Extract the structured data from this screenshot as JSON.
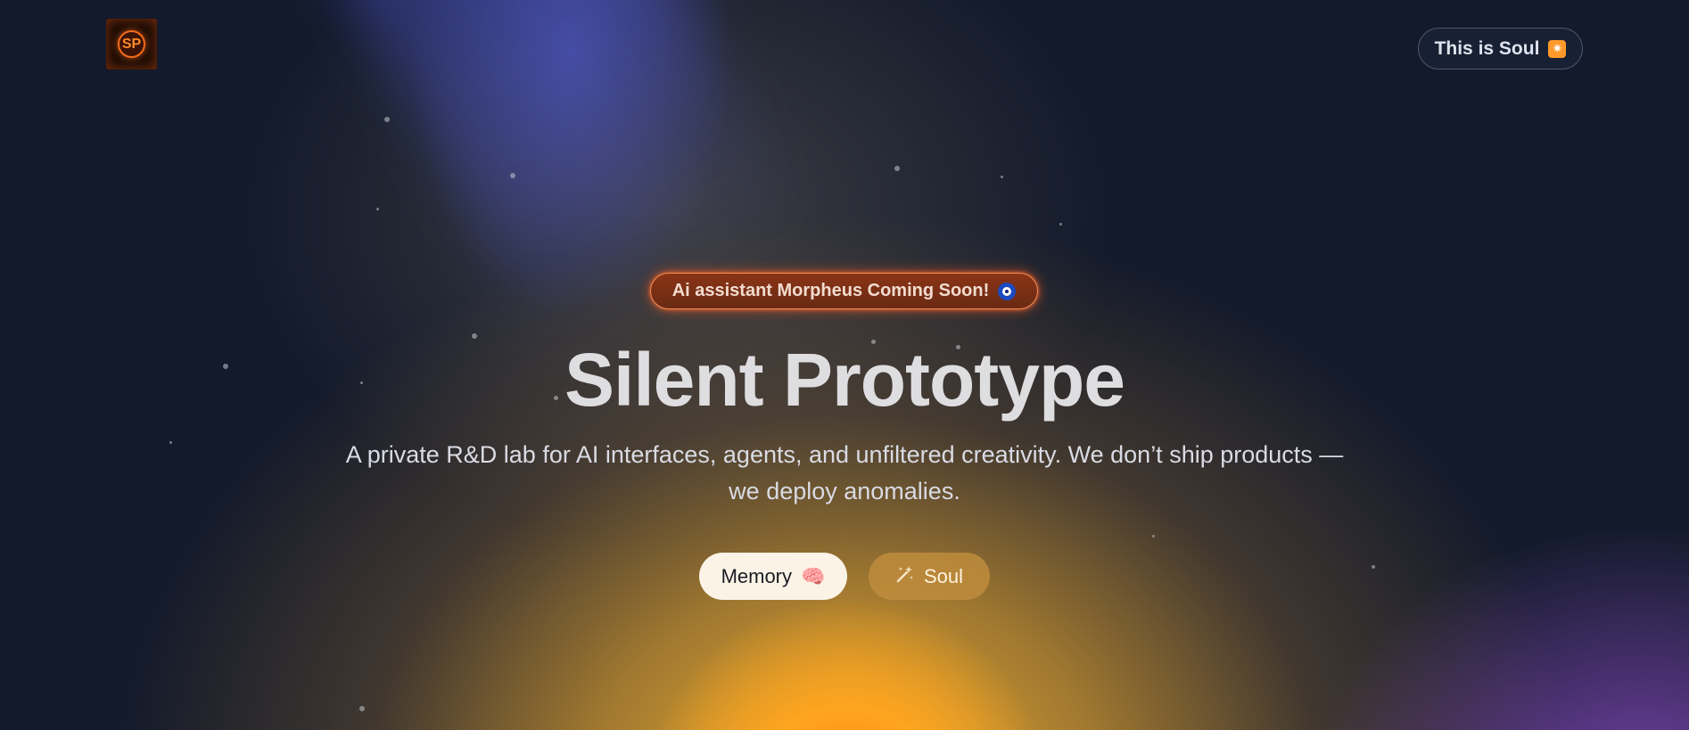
{
  "header": {
    "logo_text": "SP",
    "soul_pill": {
      "label": "This is Soul",
      "icon": "sun-icon"
    }
  },
  "hero": {
    "badge": {
      "label": "Ai assistant Morpheus Coming Soon!",
      "icon": "eye-icon"
    },
    "title": "Silent Prototype",
    "subtitle": "A private R&D lab for AI interfaces, agents, and unfiltered creativity. We don’t ship products — we deploy anomalies.",
    "buttons": [
      {
        "label": "Memory",
        "icon": "brain-icon"
      },
      {
        "label": "Soul",
        "icon": "magic-wand-icon"
      }
    ]
  },
  "colors": {
    "background": "#131a2b",
    "glow_orange": "#ff7a12",
    "glow_purple": "#9650d2",
    "badge_border": "#ff965a"
  }
}
